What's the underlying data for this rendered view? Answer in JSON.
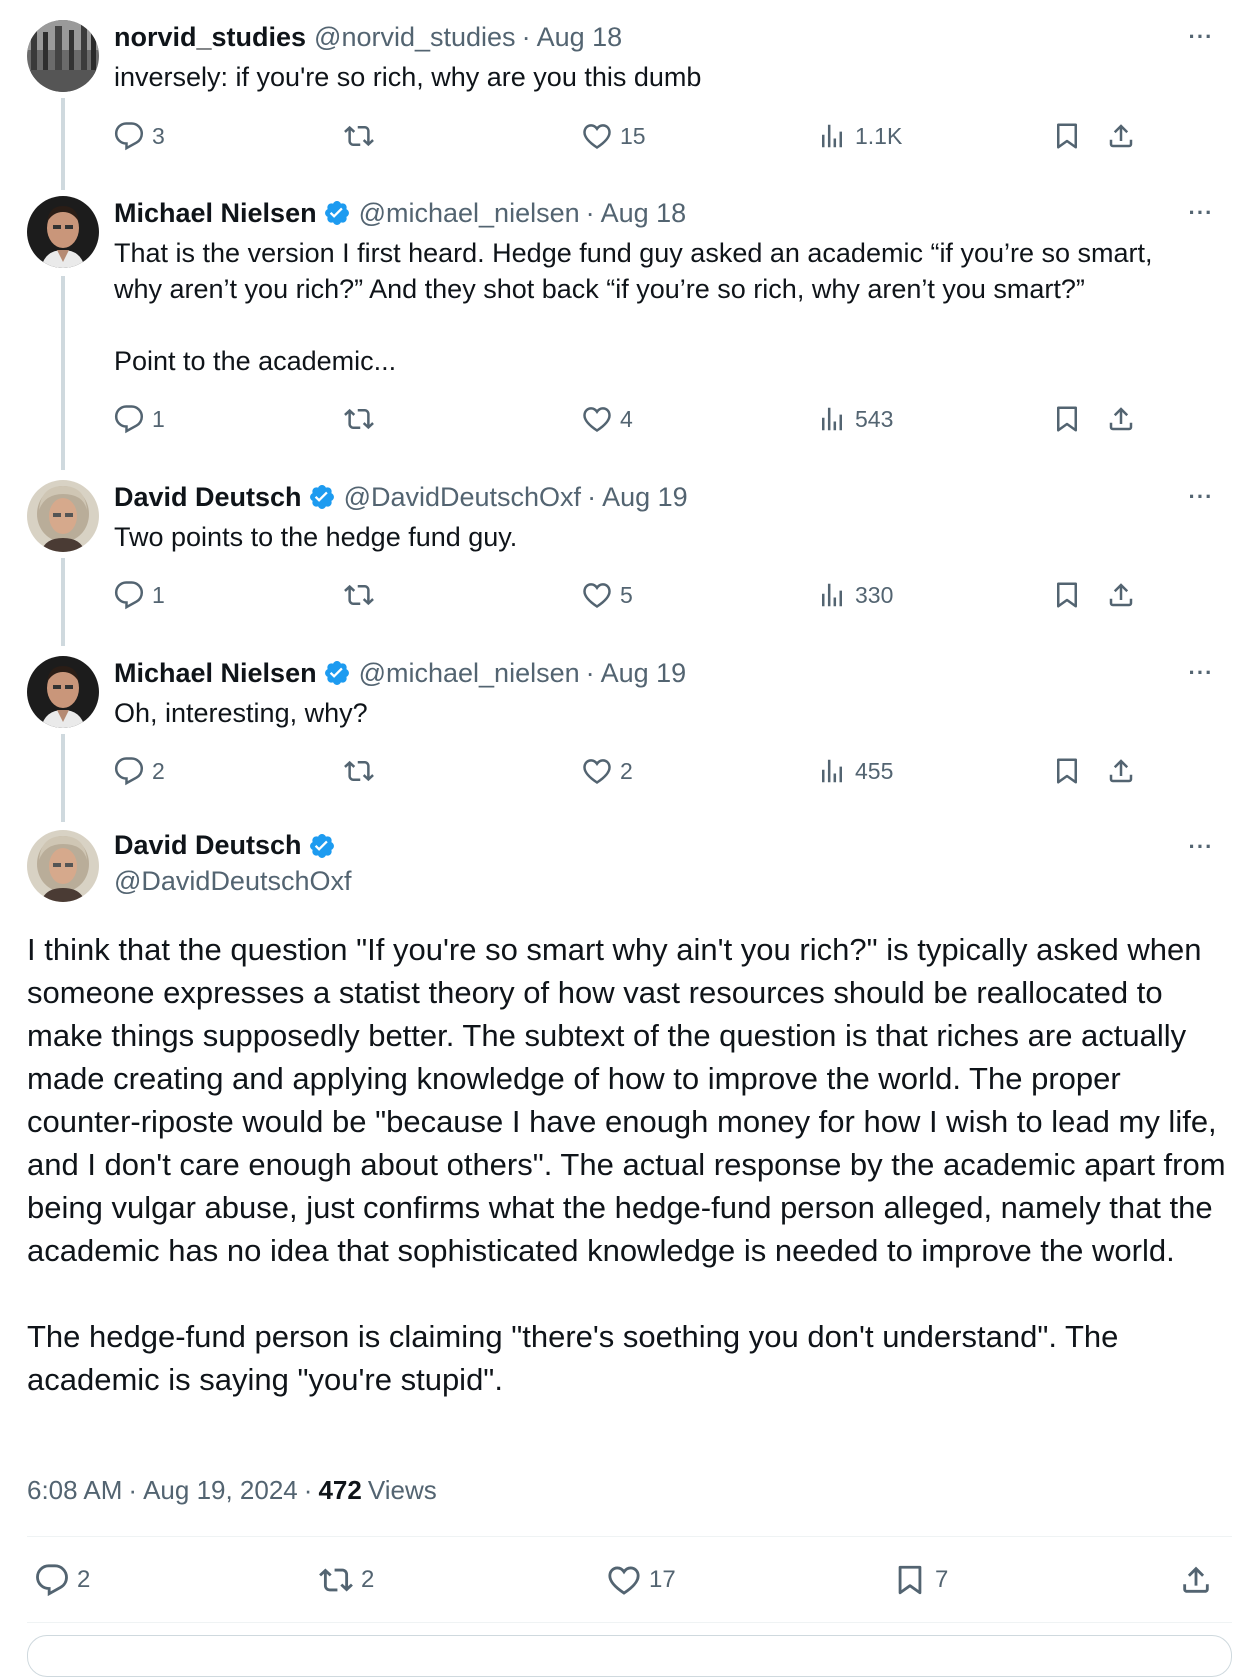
{
  "thread": [
    {
      "name": "norvid_studies",
      "verified": false,
      "handle": "@norvid_studies",
      "date": "Aug 18",
      "text": "inversely: if you're so rich, why are you this dumb",
      "replies": "3",
      "reposts": "",
      "likes": "15",
      "views": "1.1K",
      "avatar": "crowd-photo"
    },
    {
      "name": "Michael Nielsen",
      "verified": true,
      "handle": "@michael_nielsen",
      "date": "Aug 18",
      "text": "That is the version I first heard. Hedge fund guy asked an academic “if you’re so smart,\nwhy aren’t you rich?” And they shot back “if you’re so rich, why aren’t you smart?”\n\nPoint to the academic...",
      "replies": "1",
      "reposts": "",
      "likes": "4",
      "views": "543",
      "avatar": "man-portrait"
    },
    {
      "name": "David Deutsch",
      "verified": true,
      "handle": "@DavidDeutschOxf",
      "date": "Aug 19",
      "text": "Two points to the hedge fund guy.",
      "replies": "1",
      "reposts": "",
      "likes": "5",
      "views": "330",
      "avatar": "grey-hair-portrait"
    },
    {
      "name": "Michael Nielsen",
      "verified": true,
      "handle": "@michael_nielsen",
      "date": "Aug 19",
      "text": "Oh, interesting, why?",
      "replies": "2",
      "reposts": "",
      "likes": "2",
      "views": "455",
      "avatar": "man-portrait"
    }
  ],
  "main_tweet": {
    "name": "David Deutsch",
    "verified": true,
    "handle": "@DavidDeutschOxf",
    "text": "I think that the question \"If you're so smart why ain't you rich?\" is typically asked when someone expresses a statist theory of how vast resources should be reallocated to make things supposedly better. The subtext of the question is that riches are actually made creating and applying knowledge of how to improve the world. The proper counter-riposte would be \"because I have enough money for how I wish to lead my life, and I don't care enough about others\". The actual response by the academic apart from being vulgar abuse, just confirms what the hedge-fund person alleged, namely that the academic has no idea that sophisticated knowledge is needed to improve the world.\n\nThe hedge-fund person is claiming \"there's soething you don't understand\". The academic is saying \"you're stupid\".",
    "time": "6:08 AM",
    "date": "Aug 19, 2024",
    "views_count": "472",
    "views_label": "Views",
    "replies": "2",
    "reposts": "2",
    "likes": "17",
    "bookmarks": "7"
  },
  "ui": {
    "more_glyph": "···",
    "separator": "·"
  },
  "colors": {
    "verified": "#1d9bf0",
    "muted": "#536471",
    "line": "#cfd9de"
  }
}
